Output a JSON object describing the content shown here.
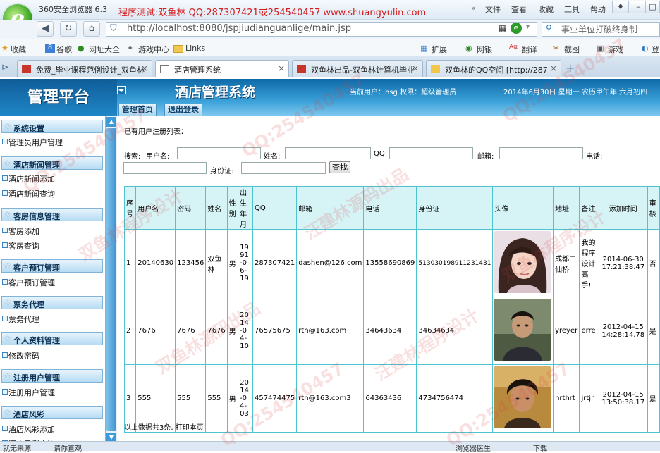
{
  "browser": {
    "name": "360安全浏览器 6.3",
    "promo": "程序测试:双鱼林 QQ:287307421或254540457 www.shuangyulin.com",
    "menu": [
      "文件",
      "查看",
      "收藏",
      "工具",
      "帮助"
    ],
    "url": "http://localhost:8080/jspjiudianguanlige/main.jsp",
    "search_text": "事业单位打破终身制",
    "bookmarks": [
      "收藏",
      "谷歌",
      "网址大全",
      "游戏中心",
      "Links"
    ],
    "toolbar_right": [
      "扩展",
      "网银",
      "翻译",
      "截图",
      "游戏",
      "登"
    ],
    "tabs": [
      {
        "label": "免费_毕业课程范例设计_双鱼林",
        "active": false
      },
      {
        "label": "酒店管理系统",
        "active": true
      },
      {
        "label": "双鱼林出品-双鱼林计算机毕业",
        "active": false
      },
      {
        "label": "双鱼林的QQ空间 [http://287",
        "active": false
      }
    ],
    "status": {
      "left": "就无来源",
      "left2": "请你直观",
      "right1": "浏览器医生",
      "right2": "下载"
    }
  },
  "app": {
    "panel_title": "管理平台",
    "system_title": "酒店管理系统",
    "user_info": "当前用户：hsg 权限：超级管理员",
    "date_info": "2014年6月30日 星期一 农历甲午年 六月初四",
    "tabs": [
      "管理首页",
      "退出登录"
    ]
  },
  "sidebar": {
    "sections": [
      {
        "title": "系统设置",
        "items": [
          "管理员用户管理"
        ]
      },
      {
        "title": "酒店新闻管理",
        "items": [
          "酒店新闻添加",
          "酒店新闻查询"
        ]
      },
      {
        "title": "客房信息管理",
        "items": [
          "客房添加",
          "客房查询"
        ]
      },
      {
        "title": "客户预订管理",
        "items": [
          "客户预订管理"
        ]
      },
      {
        "title": "票务代理",
        "items": [
          "票务代理"
        ]
      },
      {
        "title": "个人资料管理",
        "items": [
          "修改密码"
        ]
      },
      {
        "title": "注册用户管理",
        "items": [
          "注册用户管理"
        ]
      },
      {
        "title": "酒店风彩",
        "items": [
          "酒店风彩添加",
          "酒店风彩查询"
        ]
      }
    ]
  },
  "main": {
    "list_title": "已有用户注册列表：",
    "search": {
      "label_search": "搜索:",
      "label_username": "用户名:",
      "label_name": "姓名:",
      "label_qq": "QQ:",
      "label_email": "邮箱:",
      "label_phone": "电话:",
      "label_id": "身份证:",
      "button": "查找"
    },
    "columns": [
      "序号",
      "用户名",
      "密码",
      "姓名",
      "性别",
      "出生年月",
      "QQ",
      "邮箱",
      "电话",
      "身份证",
      "头像",
      "地址",
      "备注",
      "添加时间",
      "审核"
    ],
    "rows": [
      {
        "no": "1",
        "username": "20140630",
        "password": "123456",
        "name": "双鱼林",
        "gender": "男",
        "birth": "1991-06-19",
        "qq": "287307421",
        "email": "dashen@126.com",
        "phone": "13558690869",
        "idcard": "513030198911231431",
        "address": "成都二仙桥",
        "remark": "我的程序设计高手!",
        "added": "2014-06-30 17:21:38.47",
        "audit": "否"
      },
      {
        "no": "2",
        "username": "7676",
        "password": "7676",
        "name": "7676",
        "gender": "男",
        "birth": "2014-04-10",
        "qq": "76575675",
        "email": "rth@163.com",
        "phone": "34643634",
        "idcard": "34634634",
        "address": "yreyer",
        "remark": "erre",
        "added": "2012-04-15 14:28:14.78",
        "audit": "是"
      },
      {
        "no": "3",
        "username": "555",
        "password": "555",
        "name": "555",
        "gender": "男",
        "birth": "2014-04-03",
        "qq": "457474475",
        "email": "rth@163.com3",
        "phone": "64363436",
        "idcard": "4734756474",
        "address": "hrthrt",
        "remark": "jrtjr",
        "added": "2012-04-15 13:50:38.17",
        "audit": "是"
      }
    ],
    "footer": "以上数据共3条, 打印本页"
  },
  "watermark": [
    "双鱼林程序设计",
    "QQ:254540457",
    "汪建林源码出品",
    "双鱼林源码出品",
    "汪建林程序设计"
  ],
  "colors": {
    "header": "#1f86c7",
    "table_border": "#4dc4cf",
    "promo": "#d41c1c"
  }
}
